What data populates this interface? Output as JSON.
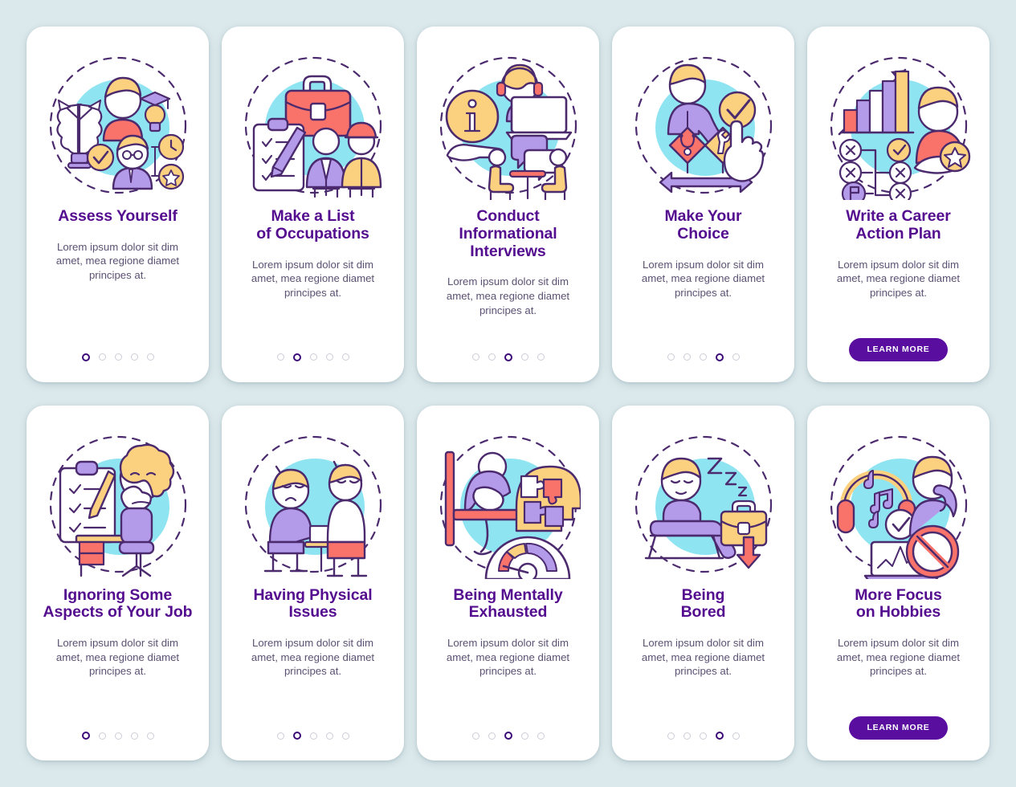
{
  "theme": {
    "background": "#dce9ec",
    "card_background": "#ffffff",
    "title_color": "#540d8f",
    "body_color": "#5b5172",
    "accent_purple": "#5a0ea0",
    "dot_active": "#3c0a78",
    "dot_inactive": "#cdcdd8",
    "illustration_blob": "#8fe4f2",
    "illustration_outline": "#4b2a6e",
    "illustration_lavender": "#b49bea",
    "illustration_yellow": "#fbd180",
    "illustration_coral": "#f9736b"
  },
  "common": {
    "body_text": "Lorem ipsum dolor sit dim\namet, mea regione diamet\nprincipes at.",
    "learn_more_label": "LEARN MORE",
    "dot_count": 5
  },
  "rows": [
    {
      "name": "career-planning-row",
      "cards": [
        {
          "title": "Assess Yourself",
          "body": "Lorem ipsum dolor sit dim\namet, mea regione diamet\nprincipes at.",
          "illustration": "brain-graduate-assessment-icon",
          "footer_type": "dots",
          "active_dot": 0,
          "dot_count": 5
        },
        {
          "title": "Make a List\nof Occupations",
          "body": "Lorem ipsum dolor sit dim\namet, mea regione diamet\nprincipes at.",
          "illustration": "briefcase-checklist-workers-icon",
          "footer_type": "dots",
          "active_dot": 1,
          "dot_count": 5
        },
        {
          "title": "Conduct\nInformational\nInterviews",
          "body": "Lorem ipsum dolor sit dim\namet, mea regione diamet\nprincipes at.",
          "illustration": "info-headset-interview-icon",
          "footer_type": "dots",
          "active_dot": 2,
          "dot_count": 5
        },
        {
          "title": "Make Your\nChoice",
          "body": "Lorem ipsum dolor sit dim\namet, mea regione diamet\nprincipes at.",
          "illustration": "career-crossroads-choice-icon",
          "footer_type": "dots",
          "active_dot": 3,
          "dot_count": 5
        },
        {
          "title": "Write a Career\nAction Plan",
          "body": "Lorem ipsum dolor sit dim\namet, mea regione diamet\nprincipes at.",
          "illustration": "growth-chart-action-plan-icon",
          "footer_type": "button",
          "button_label": "LEARN MORE"
        }
      ]
    },
    {
      "name": "burnout-signs-row",
      "cards": [
        {
          "title": "Ignoring Some\nAspects of Your Job",
          "body": "Lorem ipsum dolor sit dim\namet, mea regione diamet\nprincipes at.",
          "illustration": "yawning-woman-desk-icon",
          "footer_type": "dots",
          "active_dot": 0,
          "dot_count": 5
        },
        {
          "title": "Having Physical\nIssues",
          "body": "Lorem ipsum dolor sit dim\namet, mea regione diamet\nprincipes at.",
          "illustration": "tired-workers-headache-icon",
          "footer_type": "dots",
          "active_dot": 1,
          "dot_count": 5
        },
        {
          "title": "Being Mentally\nExhausted",
          "body": "Lorem ipsum dolor sit dim\namet, mea regione diamet\nprincipes at.",
          "illustration": "puzzle-head-gauge-icon",
          "footer_type": "dots",
          "active_dot": 2,
          "dot_count": 5
        },
        {
          "title": "Being\nBored",
          "body": "Lorem ipsum dolor sit dim\namet, mea regione diamet\nprincipes at.",
          "illustration": "sleeping-person-briefcase-icon",
          "footer_type": "dots",
          "active_dot": 3,
          "dot_count": 5
        },
        {
          "title": "More Focus\non Hobbies",
          "body": "Lorem ipsum dolor sit dim\namet, mea regione diamet\nprincipes at.",
          "illustration": "headphones-music-no-work-icon",
          "footer_type": "button",
          "button_label": "LEARN MORE"
        }
      ]
    }
  ]
}
